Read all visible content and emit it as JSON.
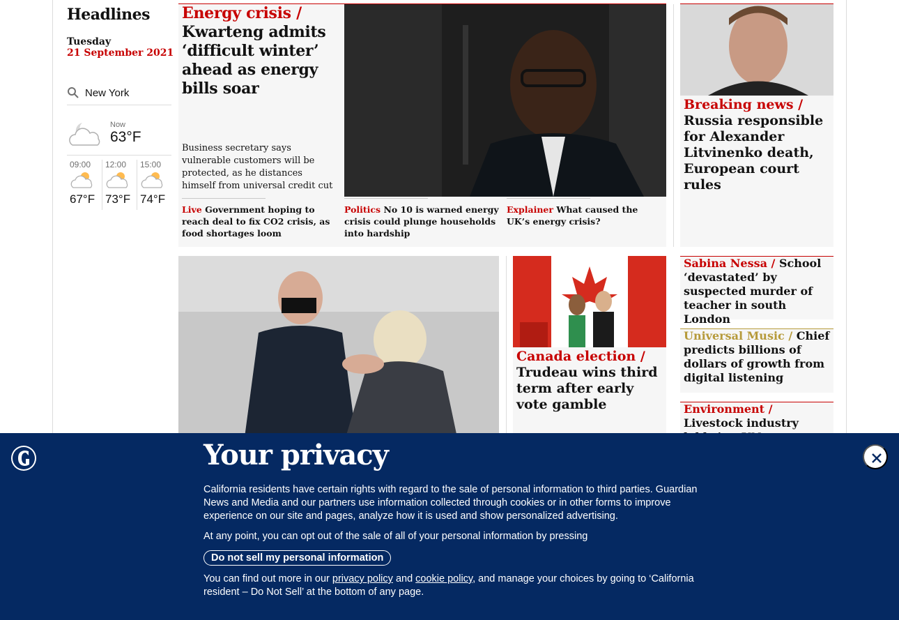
{
  "left": {
    "title": "Headlines",
    "day": "Tuesday",
    "date": "21 September 2021",
    "weather": {
      "location": "New York",
      "now_label": "Now",
      "now_temp": "63°F",
      "forecast": [
        {
          "time": "09:00",
          "temp": "67°F"
        },
        {
          "time": "12:00",
          "temp": "73°F"
        },
        {
          "time": "15:00",
          "temp": "74°F"
        }
      ]
    }
  },
  "main_story": {
    "kicker": "Energy crisis /",
    "headline": "Kwarteng admits ‘difficult winter’ ahead as energy bills soar",
    "standfirst": "Business secretary says vulnerable customers will be protected, as he distances himself from universal credit cut",
    "sublinks": [
      {
        "tag": "Live",
        "text": "Government hoping to reach deal to fix CO2 crisis, as food shortages loom"
      },
      {
        "tag": "Politics",
        "text": "No 10 is warned energy crisis could plunge households into hardship"
      },
      {
        "tag": "Explainer",
        "text": "What caused the UK’s energy crisis?"
      }
    ]
  },
  "right_card": {
    "kicker": "Breaking news /",
    "headline": "Russia responsible for Alexander Litvinenko death, European court rules"
  },
  "canada": {
    "kicker": "Canada election /",
    "headline": "Trudeau wins third term after early vote gamble"
  },
  "minis": [
    {
      "tag": "Sabina Nessa /",
      "text": "School ‘devastated’ by suspected murder of teacher in south London"
    },
    {
      "tag": "Universal Music /",
      "text": "Chief predicts billions of dollars of growth from digital listening"
    },
    {
      "tag": "Environment /",
      "text": "Livestock industry lobbying UN to"
    }
  ],
  "privacy": {
    "title": "Your privacy",
    "p1": "California residents have certain rights with regard to the sale of personal information to third parties. Guardian News and Media and our partners use information collected through cookies or in other forms to improve experience on our site and pages, analyze how it is used and show personalized advertising.",
    "p2": "At any point, you can opt out of the sale of all of your personal information by pressing",
    "button": "Do not sell my personal information",
    "p3_pre": "You can find out more in our",
    "privacy_link": "privacy policy",
    "and": "and",
    "cookie_link": "cookie policy",
    "p3_post": ", and manage your choices by going to ‘California resident – Do Not Sell’ at the bottom of any page."
  },
  "colors": {
    "accent": "#c70000",
    "banner": "#052962",
    "music": "#b69a3a"
  }
}
